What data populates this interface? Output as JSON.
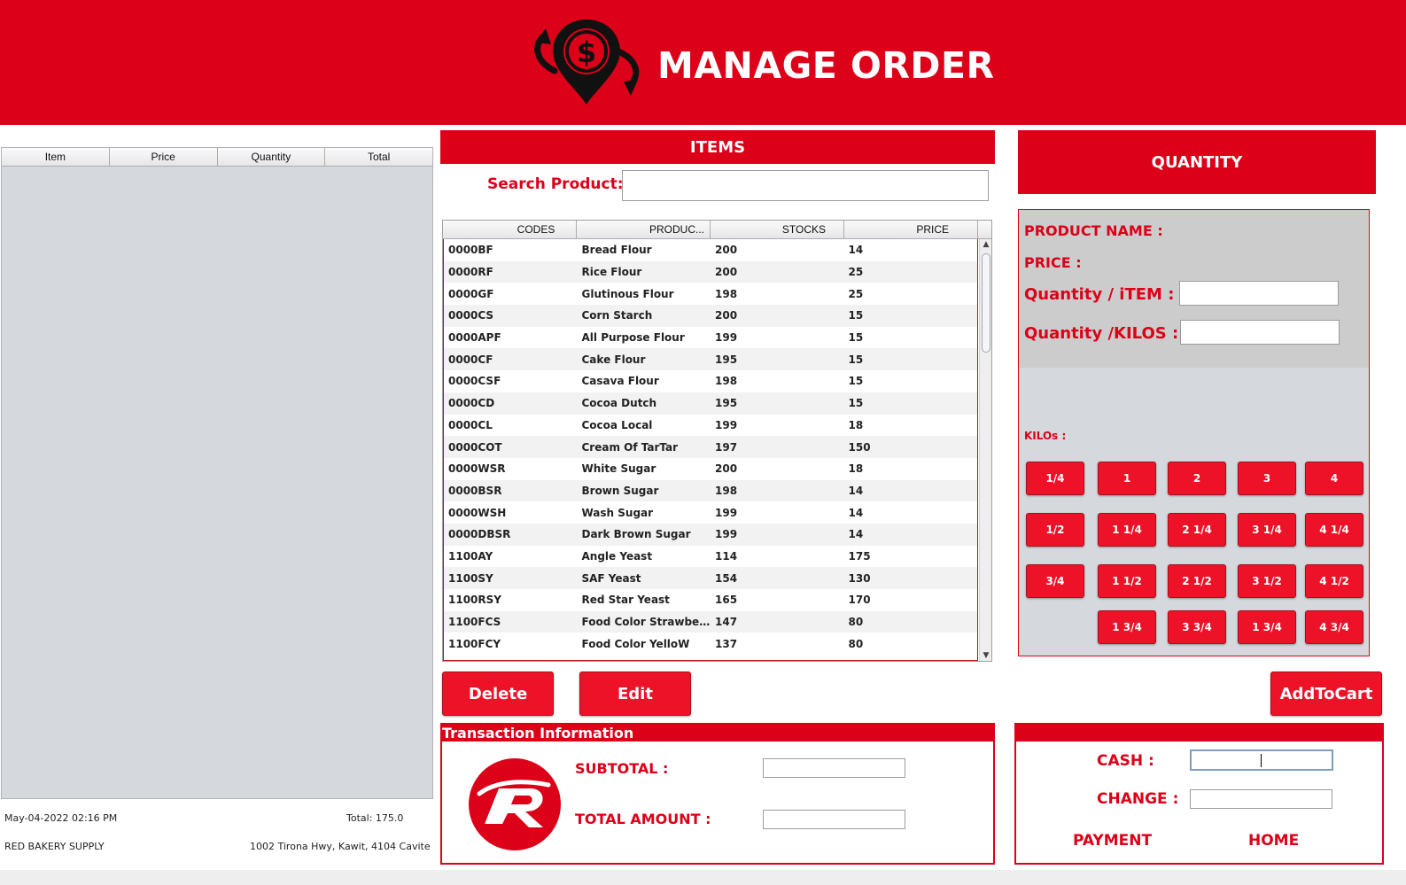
{
  "header": {
    "title": "MANAGE ORDER",
    "logo_icon": "money-location-icon",
    "color": "#dc0018"
  },
  "cart": {
    "columns": [
      "Item",
      "Price",
      "Quantity",
      "Total"
    ],
    "date": "May-04-2022 02:16 PM",
    "total": "Total: 175.0",
    "store_name": "RED BAKERY SUPPLY",
    "store_address": "1002 Tirona Hwy, Kawit, 4104 Cavite"
  },
  "items_section": {
    "title": "ITEMS",
    "search_label": "Search Product:",
    "search_value": "",
    "columns": [
      "CODES",
      "PRODUC...",
      "STOCKS",
      "PRICE"
    ],
    "rows": [
      [
        "0000BF",
        "Bread Flour",
        "200",
        "14"
      ],
      [
        "0000RF",
        "Rice Flour",
        "200",
        "25"
      ],
      [
        "0000GF",
        "Glutinous Flour",
        "198",
        "25"
      ],
      [
        "0000CS",
        "Corn Starch",
        "200",
        "15"
      ],
      [
        "0000APF",
        "All Purpose Flour",
        "199",
        "15"
      ],
      [
        "0000CF",
        "Cake Flour",
        "195",
        "15"
      ],
      [
        "0000CSF",
        "Casava Flour",
        "198",
        "15"
      ],
      [
        "0000CD",
        "Cocoa Dutch",
        "195",
        "15"
      ],
      [
        "0000CL",
        "Cocoa Local",
        "199",
        "18"
      ],
      [
        "0000COT",
        "Cream Of TarTar",
        "197",
        "150"
      ],
      [
        "0000WSR",
        "White Sugar",
        "200",
        "18"
      ],
      [
        "0000BSR",
        "Brown Sugar",
        "198",
        "14"
      ],
      [
        "0000WSH",
        "Wash Sugar",
        "199",
        "14"
      ],
      [
        "0000DBSR",
        "Dark Brown Sugar",
        "199",
        "14"
      ],
      [
        "1100AY",
        "Angle Yeast",
        "114",
        "175"
      ],
      [
        "1100SY",
        "SAF Yeast",
        "154",
        "130"
      ],
      [
        "1100RSY",
        "Red Star Yeast",
        "165",
        "170"
      ],
      [
        "1100FCS",
        "Food Color Strawber...",
        "147",
        "80"
      ],
      [
        "1100FCY",
        "Food Color YelloW",
        "137",
        "80"
      ]
    ]
  },
  "buttons": {
    "delete": "Delete",
    "edit": "Edit",
    "add_to_cart": "AddToCart"
  },
  "transaction": {
    "title": "Transaction Information",
    "subtotal_label": "SUBTOTAL :",
    "total_amount_label": "TOTAL AMOUNT :",
    "subtotal_value": "",
    "total_amount_value": ""
  },
  "quantity_section": {
    "title": "QUANTITY",
    "product_name_label": "PRODUCT NAME :",
    "price_label": "PRICE :",
    "qty_item_label": "Quantity / iTEM :",
    "qty_kilos_label": "Quantity /KILOS :",
    "qty_item_value": "",
    "qty_kilos_value": "",
    "kilos_label": "KILOs :",
    "kilo_buttons": {
      "r0": [
        "1/4",
        "1",
        "2",
        "3",
        "4"
      ],
      "r1": [
        "1/2",
        "1 1/4",
        "2 1/4",
        "3 1/4",
        "4 1/4"
      ],
      "r2": [
        "3/4",
        "1 1/2",
        "2 1/2",
        "3 1/2",
        "4 1/2"
      ],
      "r3": [
        "1 3/4",
        "3 3/4",
        "1 3/4",
        "4 3/4"
      ]
    }
  },
  "payment": {
    "cash_label": "CASH :",
    "change_label": "CHANGE :",
    "cash_value": "",
    "change_value": "",
    "payment_label": "PAYMENT",
    "home_label": "HOME"
  }
}
